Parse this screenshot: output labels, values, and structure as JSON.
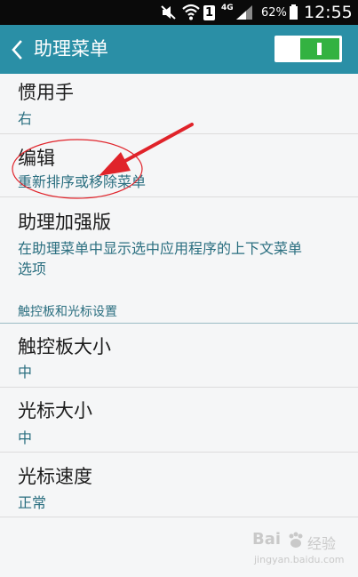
{
  "status_bar": {
    "network": "4G",
    "sim_slot": "1",
    "battery": "62%",
    "time": "12:55",
    "icons": [
      "mute-icon",
      "wifi-icon",
      "signal-icon",
      "battery-icon"
    ]
  },
  "header": {
    "title": "助理菜单",
    "toggle_on": true,
    "accent_color": "#2a8fa6",
    "toggle_color": "#33b241"
  },
  "items": [
    {
      "title": "惯用手",
      "subtitle": "右"
    },
    {
      "title": "编辑",
      "subtitle": "重新排序或移除菜单"
    },
    {
      "title": "助理加强版",
      "subtitle_line1": "在助理菜单中显示选中应用程序的上下文菜单",
      "subtitle_line2": "选项"
    }
  ],
  "section": {
    "label": "触控板和光标设置"
  },
  "items2": [
    {
      "title": "触控板大小",
      "subtitle": "中"
    },
    {
      "title": "光标大小",
      "subtitle": "中"
    },
    {
      "title": "光标速度",
      "subtitle": "正常"
    }
  ],
  "watermark": {
    "brand": "Bai",
    "brand2": "经验",
    "url": "jingyan.baidu.com"
  }
}
